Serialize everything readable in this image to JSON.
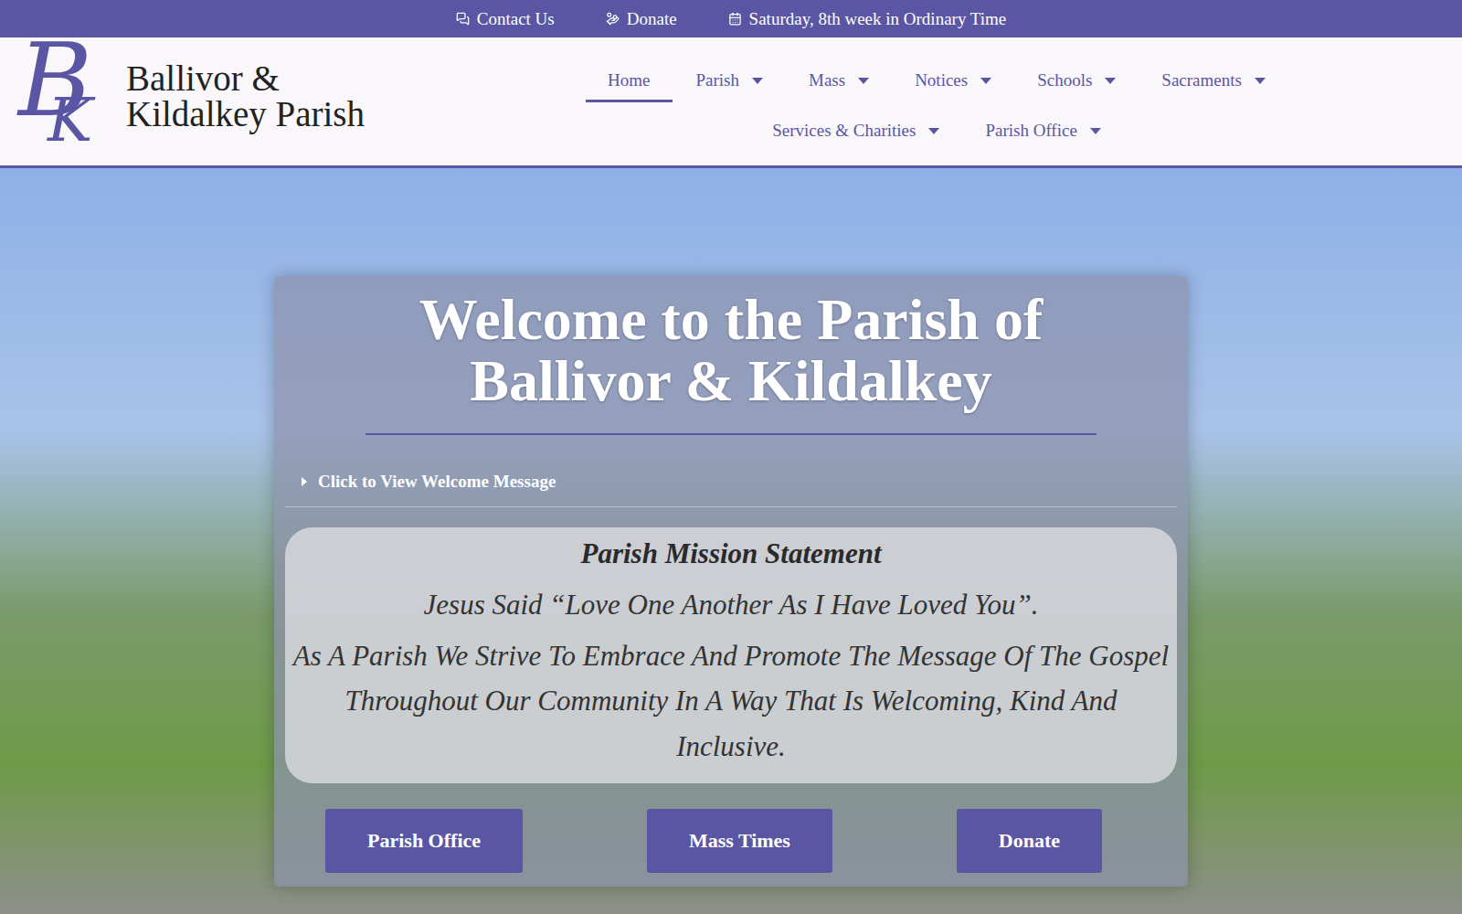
{
  "topbar": {
    "items": [
      {
        "label": "Contact Us",
        "icon": "chat"
      },
      {
        "label": "Donate",
        "icon": "donate"
      },
      {
        "label": "Saturday, 8th week in Ordinary Time",
        "icon": "calendar"
      }
    ]
  },
  "site": {
    "logo_letters": [
      "B",
      "K"
    ],
    "title_lines": [
      "Ballivor &",
      "Kildalkey Parish"
    ]
  },
  "nav": [
    {
      "label": "Home",
      "selected": true,
      "dropdown": false
    },
    {
      "label": "Parish",
      "selected": false,
      "dropdown": true
    },
    {
      "label": "Mass",
      "selected": false,
      "dropdown": true
    },
    {
      "label": "Notices",
      "selected": false,
      "dropdown": true
    },
    {
      "label": "Schools",
      "selected": false,
      "dropdown": true
    },
    {
      "label": "Sacraments",
      "selected": false,
      "dropdown": true
    },
    {
      "label": "Services & Charities",
      "selected": false,
      "dropdown": true
    },
    {
      "label": "Parish Office",
      "selected": false,
      "dropdown": true
    }
  ],
  "hero": {
    "title_lines": [
      "Welcome to the Parish of",
      "Ballivor & Kildalkey"
    ],
    "welcome_toggle": {
      "label": "Click to View Welcome Message",
      "expanded": false
    },
    "mission": {
      "title": "Parish Mission Statement",
      "quote": "Jesus Said “Love  One Another As  I Have Loved You”.",
      "statement": "As A Parish We Strive To Embrace And Promote The Message Of The Gospel Throughout Our Community In A Way That Is Welcoming, Kind And Inclusive."
    },
    "buttons": [
      "Parish Office",
      "Mass Times",
      "Donate"
    ]
  }
}
